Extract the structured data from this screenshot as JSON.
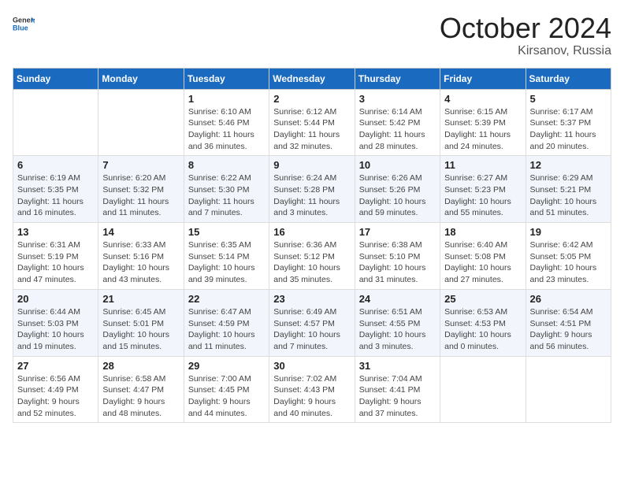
{
  "header": {
    "logo_general": "General",
    "logo_blue": "Blue",
    "month_year": "October 2024",
    "location": "Kirsanov, Russia"
  },
  "days_of_week": [
    "Sunday",
    "Monday",
    "Tuesday",
    "Wednesday",
    "Thursday",
    "Friday",
    "Saturday"
  ],
  "weeks": [
    [
      {
        "day": "",
        "sunrise": "",
        "sunset": "",
        "daylight": ""
      },
      {
        "day": "",
        "sunrise": "",
        "sunset": "",
        "daylight": ""
      },
      {
        "day": "1",
        "sunrise": "Sunrise: 6:10 AM",
        "sunset": "Sunset: 5:46 PM",
        "daylight": "Daylight: 11 hours and 36 minutes."
      },
      {
        "day": "2",
        "sunrise": "Sunrise: 6:12 AM",
        "sunset": "Sunset: 5:44 PM",
        "daylight": "Daylight: 11 hours and 32 minutes."
      },
      {
        "day": "3",
        "sunrise": "Sunrise: 6:14 AM",
        "sunset": "Sunset: 5:42 PM",
        "daylight": "Daylight: 11 hours and 28 minutes."
      },
      {
        "day": "4",
        "sunrise": "Sunrise: 6:15 AM",
        "sunset": "Sunset: 5:39 PM",
        "daylight": "Daylight: 11 hours and 24 minutes."
      },
      {
        "day": "5",
        "sunrise": "Sunrise: 6:17 AM",
        "sunset": "Sunset: 5:37 PM",
        "daylight": "Daylight: 11 hours and 20 minutes."
      }
    ],
    [
      {
        "day": "6",
        "sunrise": "Sunrise: 6:19 AM",
        "sunset": "Sunset: 5:35 PM",
        "daylight": "Daylight: 11 hours and 16 minutes."
      },
      {
        "day": "7",
        "sunrise": "Sunrise: 6:20 AM",
        "sunset": "Sunset: 5:32 PM",
        "daylight": "Daylight: 11 hours and 11 minutes."
      },
      {
        "day": "8",
        "sunrise": "Sunrise: 6:22 AM",
        "sunset": "Sunset: 5:30 PM",
        "daylight": "Daylight: 11 hours and 7 minutes."
      },
      {
        "day": "9",
        "sunrise": "Sunrise: 6:24 AM",
        "sunset": "Sunset: 5:28 PM",
        "daylight": "Daylight: 11 hours and 3 minutes."
      },
      {
        "day": "10",
        "sunrise": "Sunrise: 6:26 AM",
        "sunset": "Sunset: 5:26 PM",
        "daylight": "Daylight: 10 hours and 59 minutes."
      },
      {
        "day": "11",
        "sunrise": "Sunrise: 6:27 AM",
        "sunset": "Sunset: 5:23 PM",
        "daylight": "Daylight: 10 hours and 55 minutes."
      },
      {
        "day": "12",
        "sunrise": "Sunrise: 6:29 AM",
        "sunset": "Sunset: 5:21 PM",
        "daylight": "Daylight: 10 hours and 51 minutes."
      }
    ],
    [
      {
        "day": "13",
        "sunrise": "Sunrise: 6:31 AM",
        "sunset": "Sunset: 5:19 PM",
        "daylight": "Daylight: 10 hours and 47 minutes."
      },
      {
        "day": "14",
        "sunrise": "Sunrise: 6:33 AM",
        "sunset": "Sunset: 5:16 PM",
        "daylight": "Daylight: 10 hours and 43 minutes."
      },
      {
        "day": "15",
        "sunrise": "Sunrise: 6:35 AM",
        "sunset": "Sunset: 5:14 PM",
        "daylight": "Daylight: 10 hours and 39 minutes."
      },
      {
        "day": "16",
        "sunrise": "Sunrise: 6:36 AM",
        "sunset": "Sunset: 5:12 PM",
        "daylight": "Daylight: 10 hours and 35 minutes."
      },
      {
        "day": "17",
        "sunrise": "Sunrise: 6:38 AM",
        "sunset": "Sunset: 5:10 PM",
        "daylight": "Daylight: 10 hours and 31 minutes."
      },
      {
        "day": "18",
        "sunrise": "Sunrise: 6:40 AM",
        "sunset": "Sunset: 5:08 PM",
        "daylight": "Daylight: 10 hours and 27 minutes."
      },
      {
        "day": "19",
        "sunrise": "Sunrise: 6:42 AM",
        "sunset": "Sunset: 5:05 PM",
        "daylight": "Daylight: 10 hours and 23 minutes."
      }
    ],
    [
      {
        "day": "20",
        "sunrise": "Sunrise: 6:44 AM",
        "sunset": "Sunset: 5:03 PM",
        "daylight": "Daylight: 10 hours and 19 minutes."
      },
      {
        "day": "21",
        "sunrise": "Sunrise: 6:45 AM",
        "sunset": "Sunset: 5:01 PM",
        "daylight": "Daylight: 10 hours and 15 minutes."
      },
      {
        "day": "22",
        "sunrise": "Sunrise: 6:47 AM",
        "sunset": "Sunset: 4:59 PM",
        "daylight": "Daylight: 10 hours and 11 minutes."
      },
      {
        "day": "23",
        "sunrise": "Sunrise: 6:49 AM",
        "sunset": "Sunset: 4:57 PM",
        "daylight": "Daylight: 10 hours and 7 minutes."
      },
      {
        "day": "24",
        "sunrise": "Sunrise: 6:51 AM",
        "sunset": "Sunset: 4:55 PM",
        "daylight": "Daylight: 10 hours and 3 minutes."
      },
      {
        "day": "25",
        "sunrise": "Sunrise: 6:53 AM",
        "sunset": "Sunset: 4:53 PM",
        "daylight": "Daylight: 10 hours and 0 minutes."
      },
      {
        "day": "26",
        "sunrise": "Sunrise: 6:54 AM",
        "sunset": "Sunset: 4:51 PM",
        "daylight": "Daylight: 9 hours and 56 minutes."
      }
    ],
    [
      {
        "day": "27",
        "sunrise": "Sunrise: 6:56 AM",
        "sunset": "Sunset: 4:49 PM",
        "daylight": "Daylight: 9 hours and 52 minutes."
      },
      {
        "day": "28",
        "sunrise": "Sunrise: 6:58 AM",
        "sunset": "Sunset: 4:47 PM",
        "daylight": "Daylight: 9 hours and 48 minutes."
      },
      {
        "day": "29",
        "sunrise": "Sunrise: 7:00 AM",
        "sunset": "Sunset: 4:45 PM",
        "daylight": "Daylight: 9 hours and 44 minutes."
      },
      {
        "day": "30",
        "sunrise": "Sunrise: 7:02 AM",
        "sunset": "Sunset: 4:43 PM",
        "daylight": "Daylight: 9 hours and 40 minutes."
      },
      {
        "day": "31",
        "sunrise": "Sunrise: 7:04 AM",
        "sunset": "Sunset: 4:41 PM",
        "daylight": "Daylight: 9 hours and 37 minutes."
      },
      {
        "day": "",
        "sunrise": "",
        "sunset": "",
        "daylight": ""
      },
      {
        "day": "",
        "sunrise": "",
        "sunset": "",
        "daylight": ""
      }
    ]
  ]
}
